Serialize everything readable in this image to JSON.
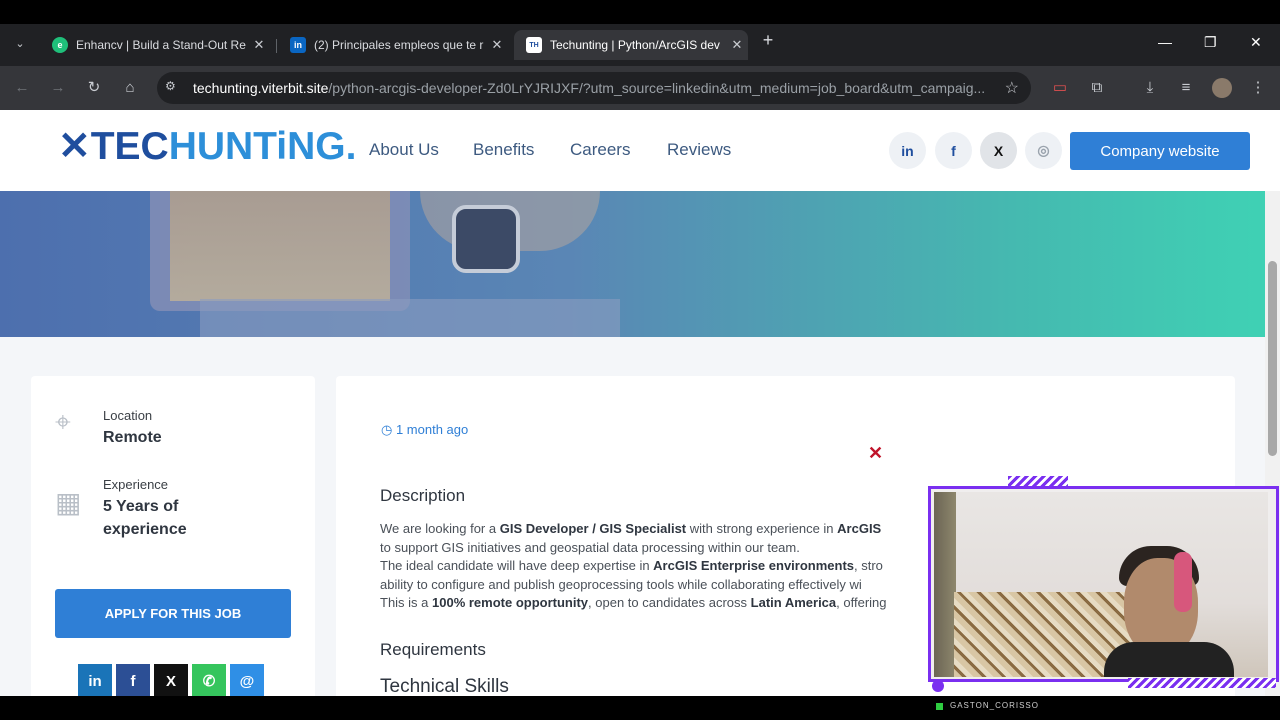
{
  "browser": {
    "tabs": [
      {
        "title": "Enhancv | Build a Stand-Out Re",
        "favicon": "enhancv-icon",
        "active": false
      },
      {
        "title": "(2) Principales empleos que te r",
        "favicon": "linkedin-icon",
        "active": false
      },
      {
        "title": "Techunting | Python/ArcGIS dev",
        "favicon": "techunting-icon",
        "active": true
      }
    ],
    "url_host": "techunting.viterbit.site",
    "url_path": "/python-arcgis-developer-Zd0LrYJRIJXF/?utm_source=linkedin&utm_medium=job_board&utm_campaig..."
  },
  "site": {
    "logo_part1": "TEC",
    "logo_part2": "HUNTiNG.",
    "nav": [
      "About Us",
      "Benefits",
      "Careers",
      "Reviews"
    ],
    "social": [
      "in",
      "f",
      "X",
      "◎"
    ],
    "company_button": "Company website"
  },
  "sidebar": {
    "location_label": "Location",
    "location_value": "Remote",
    "experience_label": "Experience",
    "experience_value": "5 Years of experience",
    "apply_button": "APPLY FOR THIS JOB",
    "share": [
      "in",
      "f",
      "X",
      "✆",
      "@"
    ]
  },
  "job": {
    "posted": "1 month ago",
    "description_heading": "Description",
    "requirements_heading": "Requirements",
    "technical_heading": "Technical Skills",
    "description": {
      "l1a": "We are looking for a ",
      "l1b": "GIS Developer / GIS Specialist",
      "l1c": " with strong experience in ",
      "l1d": "ArcGIS",
      "l2": "to support GIS initiatives and geospatial data processing within our team.",
      "l3a": "The ideal candidate will have deep expertise in ",
      "l3b": "ArcGIS Enterprise environments",
      "l3c": ", stro",
      "l4": "ability to configure and publish geoprocessing tools while collaborating effectively wi",
      "l5a": "This is a ",
      "l5b": "100% remote opportunity",
      "l5c": ", open to candidates across ",
      "l5d": "Latin America",
      "l5e": ", offering"
    }
  },
  "overlay": {
    "streamer_name": "GASTON_CORISSO"
  },
  "colors": {
    "brand_blue": "#2f7fd6",
    "logo_dark": "#1f4e9e",
    "webcam_frame": "#7a2ff0",
    "close_red": "#c0142a"
  }
}
